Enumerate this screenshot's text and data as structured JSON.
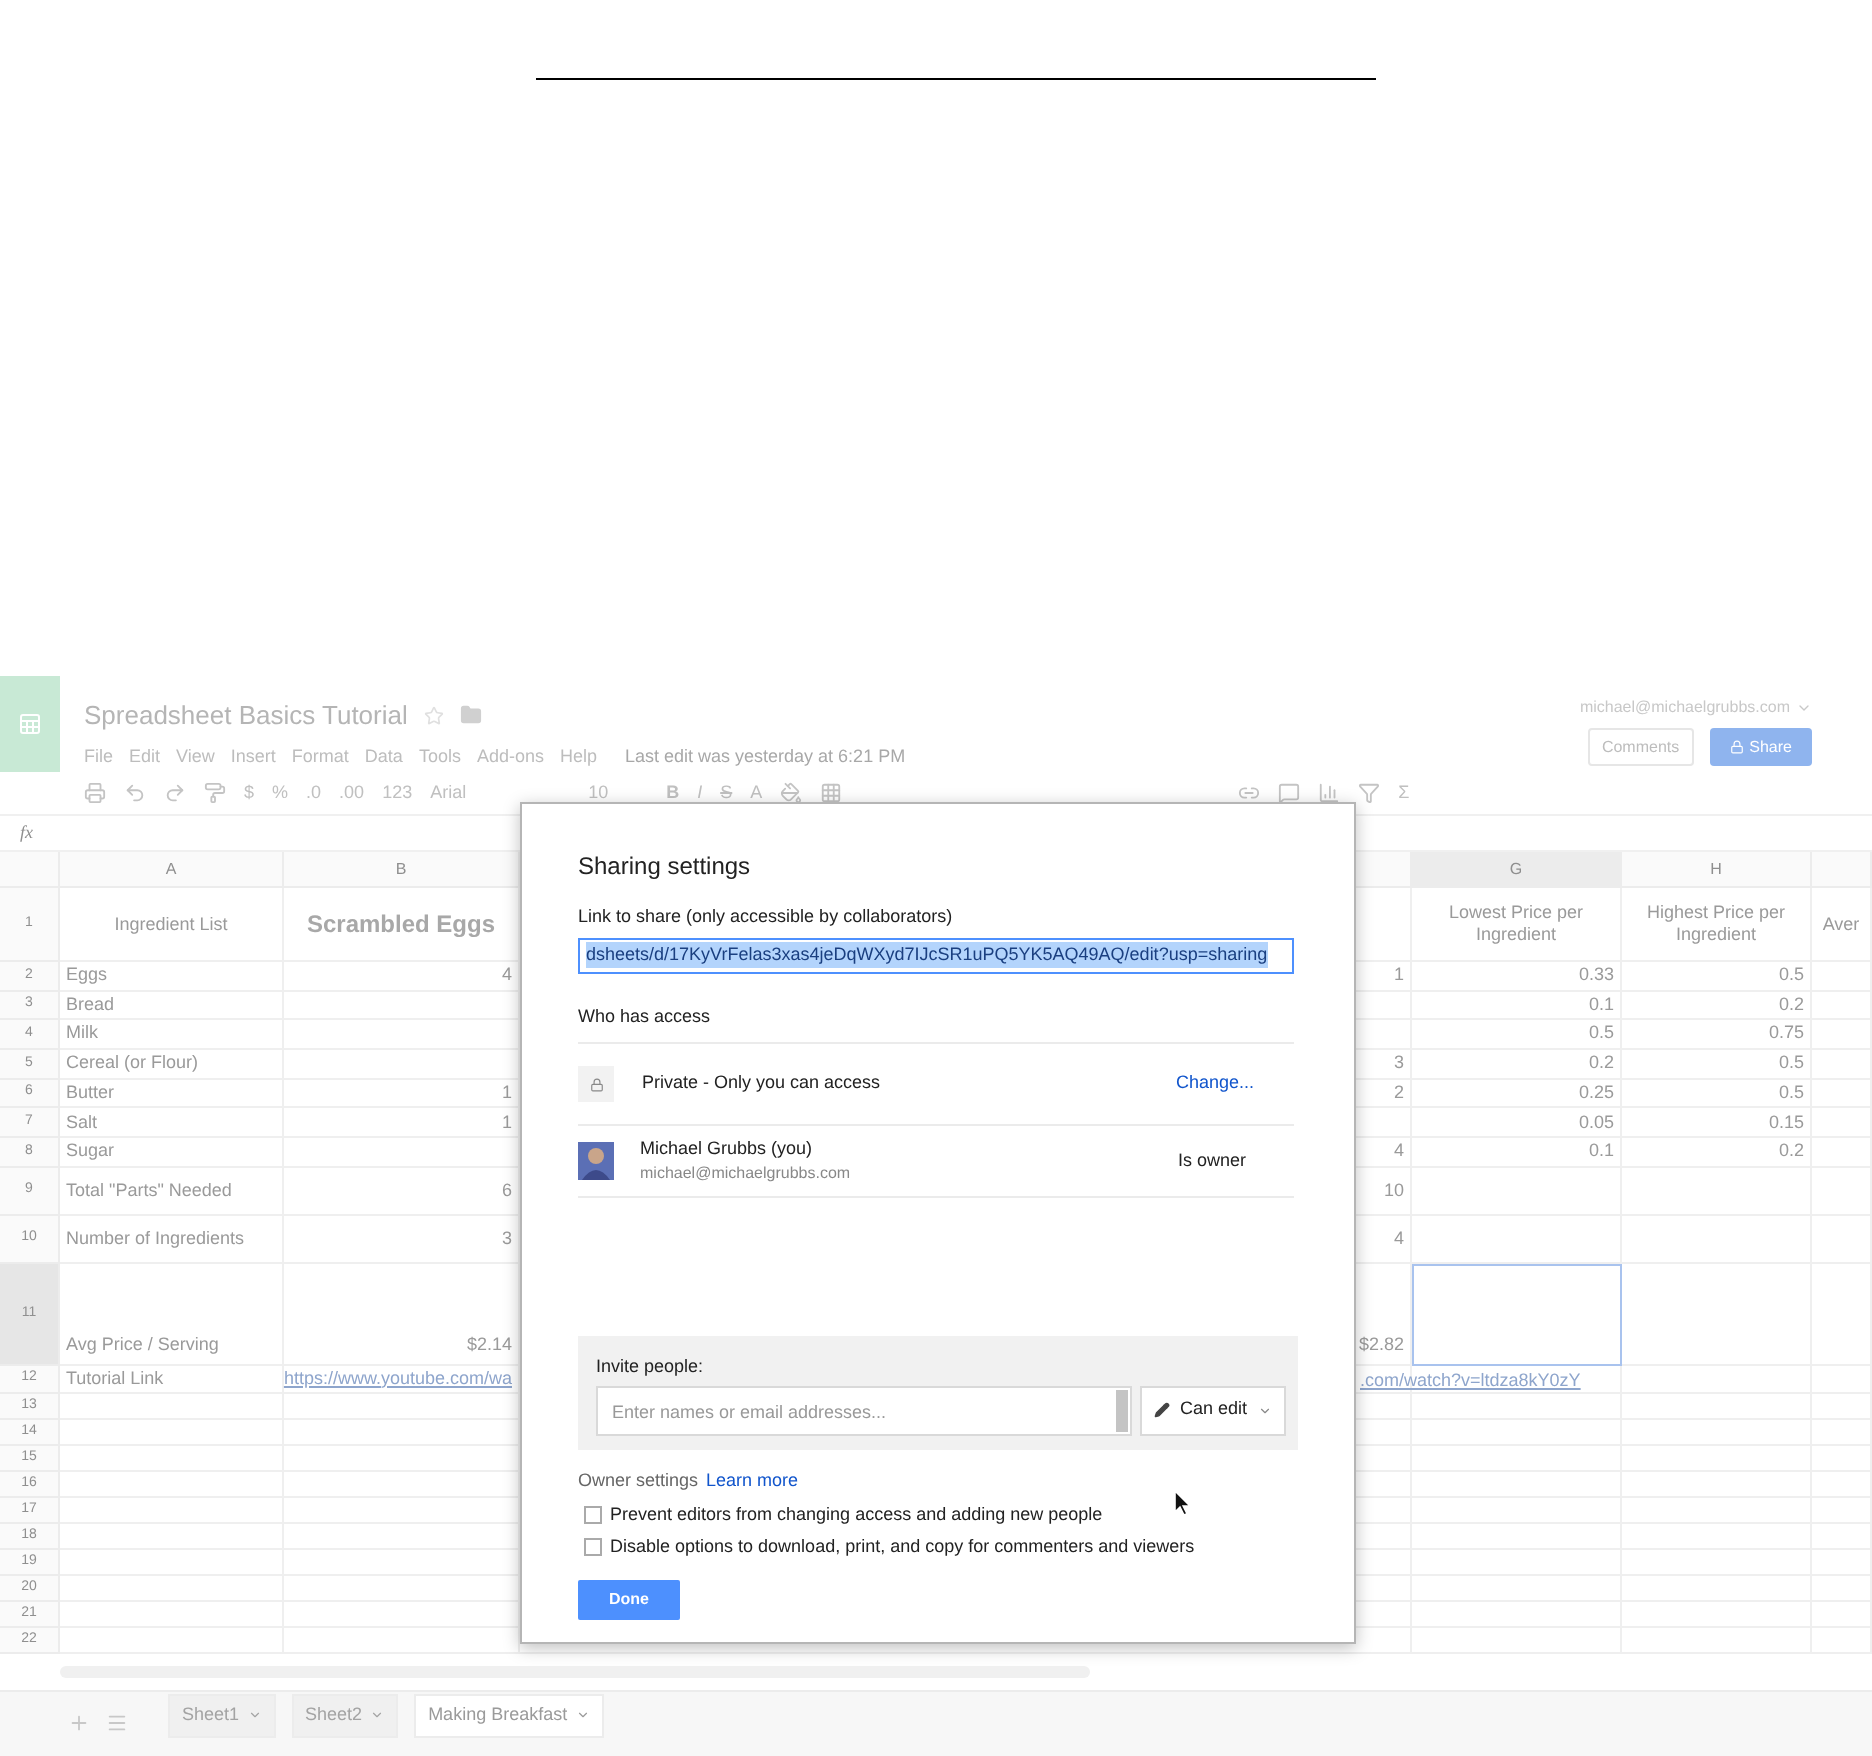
{
  "document": {
    "title": "Spreadsheet Basics Tutorial",
    "menu": [
      "File",
      "Edit",
      "View",
      "Insert",
      "Format",
      "Data",
      "Tools",
      "Add-ons",
      "Help"
    ],
    "last_edit": "Last edit was yesterday at 6:21 PM",
    "account": "michael@michaelgrubbs.com",
    "comments_button": "Comments",
    "share_button": "Share"
  },
  "toolbar": {
    "currency": "$",
    "percent": "%",
    "decimals_less": ".0",
    "decimals_more": ".00",
    "more_formats": "123",
    "font": "Arial",
    "font_size": "10",
    "bold": "B",
    "italic": "I",
    "strike": "S",
    "text_color": "A",
    "sum": "Σ"
  },
  "formula_bar": {
    "label": "fx"
  },
  "sheet": {
    "columns": [
      "A",
      "B",
      null,
      "G",
      "H",
      null
    ],
    "rows": [
      {
        "number": "1",
        "kind": "title",
        "selection": false,
        "cells": [
          "Ingredient List",
          "Scrambled Eggs",
          "",
          "Lowest Price per Ingredient",
          "Highest Price per Ingredient",
          "Aver"
        ]
      },
      {
        "number": "2",
        "kind": "item",
        "selection": false,
        "cells": [
          "Eggs",
          "4",
          "1",
          "0.33",
          "0.5",
          ""
        ]
      },
      {
        "number": "3",
        "kind": "item",
        "selection": false,
        "cells": [
          "Bread",
          "",
          "",
          "0.1",
          "0.2",
          ""
        ]
      },
      {
        "number": "4",
        "kind": "item",
        "selection": false,
        "cells": [
          "Milk",
          "",
          "",
          "0.5",
          "0.75",
          ""
        ]
      },
      {
        "number": "5",
        "kind": "item",
        "selection": false,
        "cells": [
          "Cereal (or Flour)",
          "",
          "3",
          "0.2",
          "0.5",
          ""
        ]
      },
      {
        "number": "6",
        "kind": "item",
        "selection": false,
        "cells": [
          "Butter",
          "1",
          "2",
          "0.25",
          "0.5",
          ""
        ]
      },
      {
        "number": "7",
        "kind": "item",
        "selection": false,
        "cells": [
          "Salt",
          "1",
          "",
          "0.05",
          "0.15",
          ""
        ]
      },
      {
        "number": "8",
        "kind": "item",
        "selection": false,
        "cells": [
          "Sugar",
          "",
          "4",
          "0.1",
          "0.2",
          ""
        ]
      },
      {
        "number": "9",
        "kind": "summary",
        "selection": false,
        "cells": [
          "Total \"Parts\" Needed",
          "6",
          "10",
          "",
          "",
          ""
        ]
      },
      {
        "number": "10",
        "kind": "summary",
        "selection": false,
        "cells": [
          "Number of Ingredients",
          "3",
          "4",
          "",
          "",
          ""
        ]
      },
      {
        "number": "11",
        "kind": "price",
        "selection": true,
        "cells": [
          "Avg Price / Serving",
          "$2.14",
          "$2.82",
          "",
          "",
          ""
        ]
      },
      {
        "number": "12",
        "kind": "link",
        "selection": false,
        "cells": [
          "Tutorial Link",
          "https://www.youtube.com/wa",
          ".com/watch?v=ltdza8kY0zY",
          "",
          "",
          ""
        ]
      },
      {
        "number": "13",
        "kind": "empty",
        "selection": false
      },
      {
        "number": "14",
        "kind": "empty",
        "selection": false
      },
      {
        "number": "15",
        "kind": "empty",
        "selection": false
      },
      {
        "number": "16",
        "kind": "empty",
        "selection": false
      },
      {
        "number": "17",
        "kind": "empty",
        "selection": false
      },
      {
        "number": "18",
        "kind": "empty",
        "selection": false
      },
      {
        "number": "19",
        "kind": "empty",
        "selection": false
      },
      {
        "number": "20",
        "kind": "empty",
        "selection": false
      },
      {
        "number": "21",
        "kind": "empty",
        "selection": false
      },
      {
        "number": "22",
        "kind": "empty",
        "selection": false
      }
    ]
  },
  "sheet_tabs": [
    {
      "label": "Sheet1",
      "selected": false
    },
    {
      "label": "Sheet2",
      "selected": false
    },
    {
      "label": "Making Breakfast",
      "selected": true
    }
  ],
  "dialog": {
    "title": "Sharing settings",
    "link_label": "Link to share (only accessible by collaborators)",
    "link_value": "dsheets/d/17KyVrFelas3xas4jeDqWXyd7IJcSR1uPQ5YK5AQ49AQ/edit?usp=sharing",
    "link_text_selected": true,
    "access_heading": "Who has access",
    "access": [
      {
        "kind": "visibility",
        "label": "Private - Only you can access",
        "action": "Change..."
      },
      {
        "kind": "person",
        "name": "Michael Grubbs (you)",
        "email": "michael@michaelgrubbs.com",
        "role": "Is owner"
      }
    ],
    "invite": {
      "label": "Invite people:",
      "placeholder": "Enter names or email addresses...",
      "permission": "Can edit"
    },
    "owner_settings": {
      "label": "Owner settings",
      "link": "Learn more",
      "options": [
        {
          "label": "Prevent editors from changing access and adding new people",
          "checked": false
        },
        {
          "label": "Disable options to download, print, and copy for commenters and viewers",
          "checked": false
        }
      ]
    },
    "done_button": "Done"
  }
}
